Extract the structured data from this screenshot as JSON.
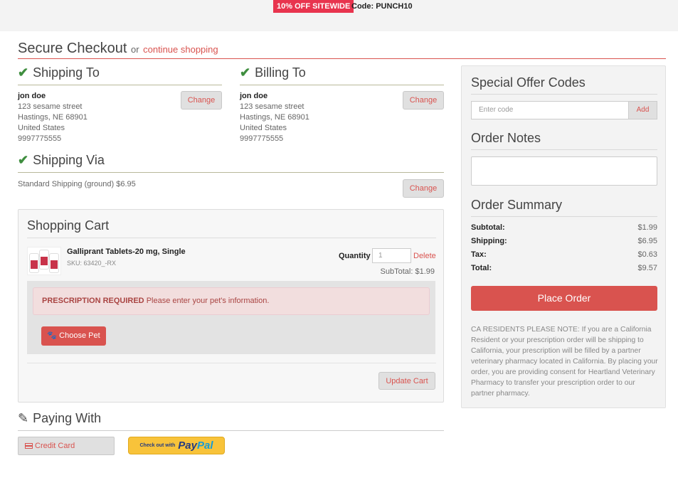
{
  "promo": {
    "badge": "10% OFF SITEWIDE",
    "code_text": "Code: PUNCH10"
  },
  "checkout": {
    "title": "Secure Checkout",
    "or": "or",
    "continue_link": "continue shopping"
  },
  "shipping_to": {
    "heading": "Shipping To",
    "name": "jon doe",
    "street": "123 sesame street",
    "city": "Hastings, NE 68901",
    "country": "United States",
    "phone": "9997775555",
    "change_label": "Change"
  },
  "billing_to": {
    "heading": "Billing To",
    "name": "jon doe",
    "street": "123 sesame street",
    "city": "Hastings, NE 68901",
    "country": "United States",
    "phone": "9997775555",
    "change_label": "Change"
  },
  "shipping_via": {
    "heading": "Shipping Via",
    "method": "Standard Shipping (ground) $6.95",
    "change_label": "Change"
  },
  "cart": {
    "heading": "Shopping Cart",
    "product_name": "Galliprant Tablets-20 mg, Single",
    "sku": "SKU: 63420_-RX",
    "quantity_label": "Quantity",
    "quantity_value": "1",
    "delete_label": "Delete",
    "subtotal": "SubTotal: $1.99",
    "rx_required": "PRESCRIPTION REQUIRED",
    "rx_message": "Please enter your pet's information.",
    "choose_pet_label": "Choose Pet",
    "update_label": "Update Cart"
  },
  "paying_with": {
    "heading": "Paying With",
    "credit_card_label": "Credit Card",
    "paypal_small": "Check out with",
    "paypal_pay": "Pay",
    "paypal_pal": "Pal"
  },
  "sidebar": {
    "offer_heading": "Special Offer Codes",
    "code_placeholder": "Enter code",
    "add_label": "Add",
    "notes_heading": "Order Notes",
    "summary_heading": "Order Summary",
    "summary": [
      {
        "label": "Subtotal:",
        "value": "$1.99"
      },
      {
        "label": "Shipping:",
        "value": "$6.95"
      },
      {
        "label": "Tax:",
        "value": "$0.63"
      },
      {
        "label": "Total:",
        "value": "$9.57"
      }
    ],
    "place_order_label": "Place Order",
    "ca_note": "CA RESIDENTS PLEASE NOTE: If you are a California Resident or your prescription order will be shipping to California, your prescription will be filled by a partner veterinary pharmacy located in California. By placing your order, you are providing consent for Heartland Veterinary Pharmacy to transfer your prescription order to our partner pharmacy."
  },
  "colors": {
    "accent": "#d9534f",
    "check": "#3f8e3f",
    "promo": "#e8344e",
    "paypal": "#f8c33a"
  }
}
